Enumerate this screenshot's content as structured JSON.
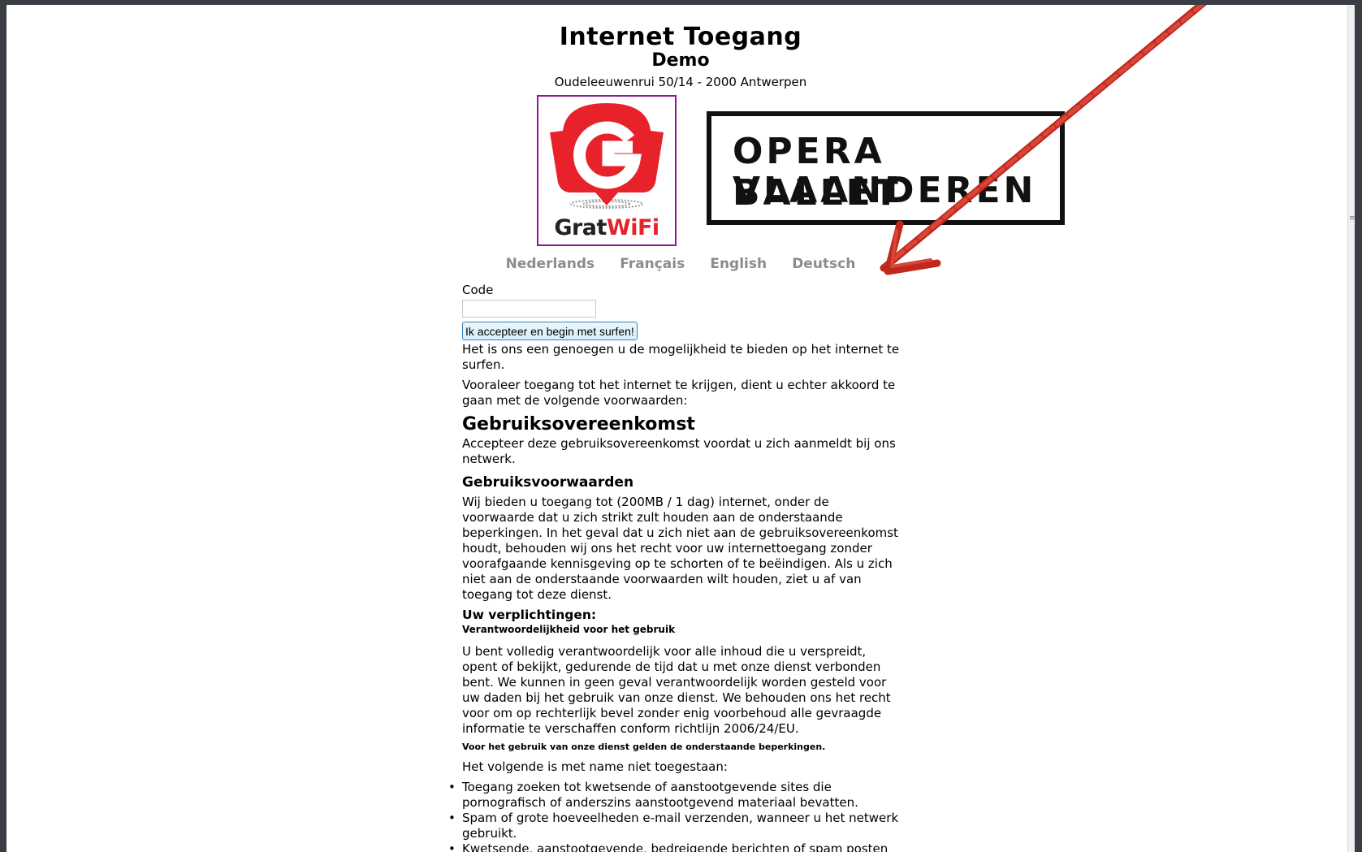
{
  "header": {
    "title": "Internet Toegang",
    "subtitle": "Demo",
    "address": "Oudeleeuwenrui 50/14 - 2000 Antwerpen"
  },
  "logos": {
    "gratwifi": {
      "part1": "Grat",
      "part2": "WiFi",
      "accent": "#e8222b",
      "border": "#8b1a8b"
    },
    "opera": {
      "line1": "OPERA BALLET",
      "line2": "VLAANDEREN"
    }
  },
  "languages": [
    "Nederlands",
    "Français",
    "English",
    "Deutsch"
  ],
  "form": {
    "code_label": "Code",
    "code_value": "",
    "accept_button": "Ik accepteer en begin met surfen!"
  },
  "terms": {
    "intro1": "Het is ons een genoegen u de mogelijkheid te bieden op het internet te surfen.",
    "intro2": "Vooraleer toegang tot het internet te krijgen, dient u echter akkoord te gaan met de volgende voorwaarden:",
    "agreement_title": "Gebruiksovereenkomst",
    "agreement_text": "Accepteer deze gebruiksovereenkomst voordat u zich aanmeldt bij ons netwerk.",
    "conditions_title": "Gebruiksvoorwaarden",
    "conditions_text": "Wij bieden u toegang tot (200MB / 1 dag) internet, onder de voorwaarde dat u zich strikt zult houden aan de onderstaande beperkingen. In het geval dat u zich niet aan de gebruiksovereenkomst houdt, behouden wij ons het recht voor uw internettoegang zonder voorafgaande kennisgeving op te schorten of te beëindigen. Als u zich niet aan de onderstaande voorwaarden wilt houden, ziet u af van toegang tot deze dienst.",
    "obligations_title": "Uw verplichtingen:",
    "responsibility_title": "Verantwoordelijkheid voor het gebruik",
    "responsibility_text": "U bent volledig verantwoordelijk voor alle inhoud die u verspreidt, opent of bekijkt, gedurende de tijd dat u met onze dienst verbonden bent. We kunnen in geen geval verantwoordelijk worden gesteld voor uw daden bij het gebruik van onze dienst. We behouden ons het recht voor om op rechterlijk bevel zonder enig voorbehoud alle gevraagde informatie te verschaffen conform richtlijn 2006/24/EU.",
    "restrictions_title": "Voor het gebruik van onze dienst gelden de onderstaande beperkingen.",
    "prohibited_intro": "Het volgende is met name niet toegestaan:",
    "prohibited": [
      "Toegang zoeken tot kwetsende of aanstootgevende sites die pornografisch of anderszins aanstootgevend materiaal bevatten.",
      "Spam of grote hoeveelheden e-mail verzenden, wanneer u het netwerk gebruikt.",
      "Kwetsende, aanstootgevende, bedreigende berichten of spam posten of"
    ]
  },
  "annotation": {
    "arrow_color": "#c0281c"
  }
}
